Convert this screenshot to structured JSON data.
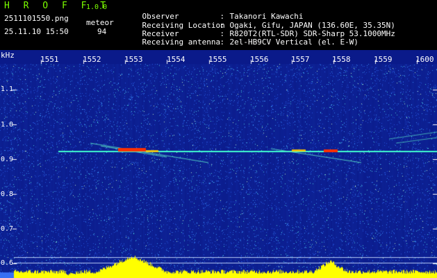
{
  "app": {
    "title": "H R O F F T",
    "version": "1.0.0"
  },
  "capture": {
    "filename": "2511101550.png",
    "type_label": "meteor",
    "datetime": "25.11.10 15:50",
    "count": "94"
  },
  "info": [
    {
      "label": "Observer",
      "value": "Takanori Kawachi"
    },
    {
      "label": "Receiving Location",
      "value": "Ogaki, Gifu, JAPAN (136.60E, 35.35N)"
    },
    {
      "label": "Receiver",
      "value": "R820T2(RTL-SDR) SDR-Sharp 53.1000MHz"
    },
    {
      "label": "Receiving antenna",
      "value": "2el-HB9CV Vertical (el. E-W)"
    }
  ],
  "info_separator": ":",
  "x_axis": {
    "ticks": [
      "1551",
      "1552",
      "1553",
      "1554",
      "1555",
      "1556",
      "1557",
      "1558",
      "1559",
      "1600"
    ]
  },
  "y_axis": {
    "unit": "kHz",
    "ticks": [
      "1.1",
      "1.0",
      "0.9",
      "0.8",
      "0.7",
      "0.6"
    ]
  },
  "colors": {
    "header_green": "#7cff00",
    "header_white": "#ffffff",
    "background": "#0a1a8a",
    "carrier": "#40ffd0",
    "meteor": "#ff3000",
    "bottom_bar": "#ffff00"
  }
}
